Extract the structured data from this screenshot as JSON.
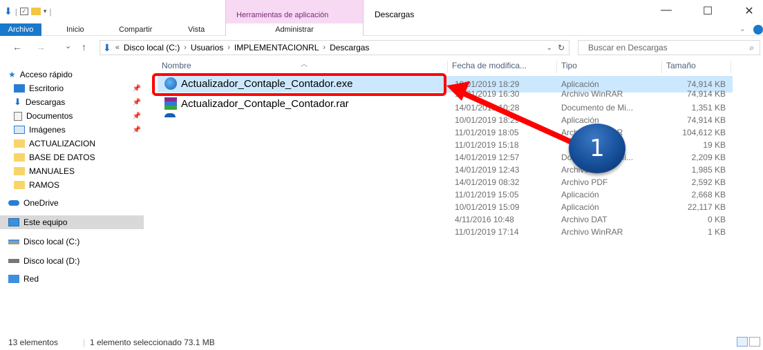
{
  "title": {
    "context_header": "Herramientas de aplicación",
    "window_title": "Descargas"
  },
  "ribbon": {
    "tabs": [
      "Archivo",
      "Inicio",
      "Compartir",
      "Vista"
    ],
    "context_tab": "Administrar"
  },
  "address": {
    "back_glyph": "←",
    "forward_glyph": "→",
    "recent_glyph": "⌄",
    "up_glyph": "↑",
    "overflow": "«",
    "crumbs": [
      "Disco local (C:)",
      "Usuarios",
      "IMPLEMENTACIONRL",
      "Descargas"
    ],
    "search_placeholder": "Buscar en Descargas"
  },
  "nav": {
    "quick_access": "Acceso rápido",
    "pinned": [
      "Escritorio",
      "Descargas",
      "Documentos",
      "Imágenes"
    ],
    "folders": [
      "ACTUALIZACION",
      "BASE DE DATOS",
      "MANUALES",
      "RAMOS"
    ],
    "onedrive": "OneDrive",
    "this_pc": "Este equipo",
    "drive_c": "Disco local (C:)",
    "drive_d": "Disco local (D:)",
    "network": "Red"
  },
  "columns": {
    "name": "Nombre",
    "date": "Fecha de modifica...",
    "type": "Tipo",
    "size": "Tamaño"
  },
  "files": [
    {
      "name": "Actualizador_Contaple_Contador.exe",
      "date": "10/01/2019 18:29",
      "type": "Aplicación",
      "size": "74,914 KB"
    },
    {
      "name": "Actualizador_Contaple_Contador.rar",
      "date": "10/01/2019 16:30",
      "type": "Archivo WinRAR",
      "size": "74,914 KB"
    },
    {
      "name": "",
      "date": "14/01/2019 10:28",
      "type": "Documento de Mi...",
      "size": "1,351 KB"
    },
    {
      "name": "",
      "date": "10/01/2019 18:29",
      "type": "Aplicación",
      "size": "74,914 KB"
    },
    {
      "name": "",
      "date": "11/01/2019 18:05",
      "type": "Archivo WinRAR",
      "size": "104,612 KB"
    },
    {
      "name": "",
      "date": "11/01/2019 15:18",
      "type": "",
      "size": "19 KB"
    },
    {
      "name": "",
      "date": "14/01/2019 12:57",
      "type": "Documento de Mi...",
      "size": "2,209 KB"
    },
    {
      "name": "",
      "date": "14/01/2019 12:43",
      "type": "Archivo",
      "size": "1,985 KB"
    },
    {
      "name": "",
      "date": "14/01/2019 08:32",
      "type": "Archivo PDF",
      "size": "2,592 KB"
    },
    {
      "name": "",
      "date": "11/01/2019 15:05",
      "type": "Aplicación",
      "size": "2,668 KB"
    },
    {
      "name": "",
      "date": "10/01/2019 15:09",
      "type": "Aplicación",
      "size": "22,117 KB"
    },
    {
      "name": "",
      "date": "4/11/2016 10:48",
      "type": "Archivo DAT",
      "size": "0 KB"
    },
    {
      "name": "",
      "date": "11/01/2019 17:14",
      "type": "Archivo WinRAR",
      "size": "1 KB"
    }
  ],
  "callout": {
    "number": "1"
  },
  "status": {
    "count": "13 elementos",
    "selection": "1 elemento seleccionado  73.1 MB"
  }
}
